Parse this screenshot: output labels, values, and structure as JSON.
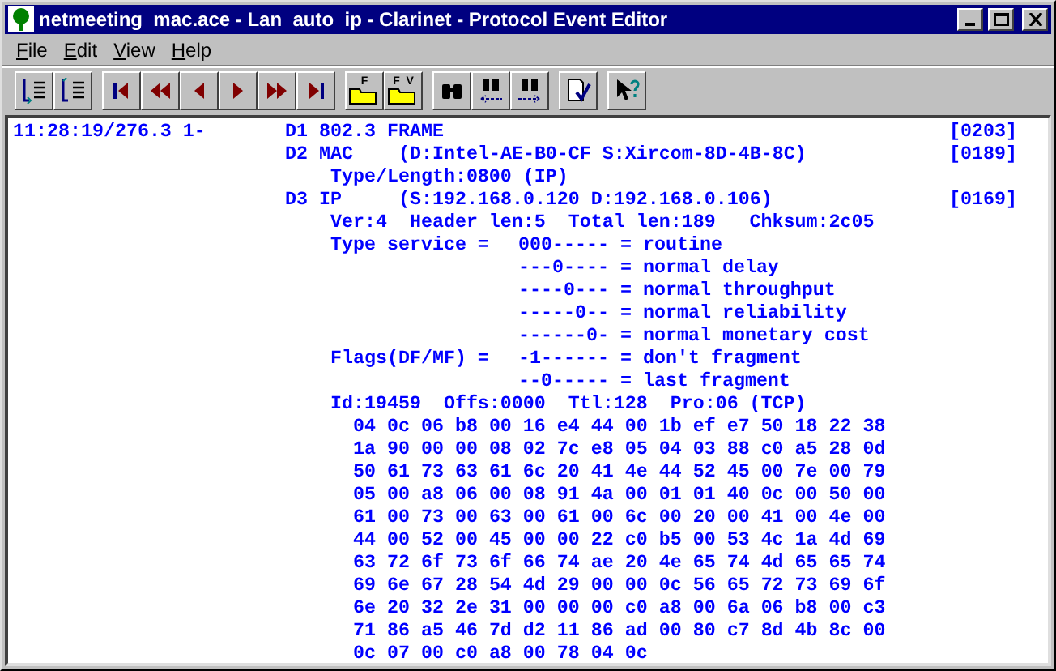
{
  "window": {
    "title": "netmeeting_mac.ace - Lan_auto_ip - Clarinet - Protocol Event Editor"
  },
  "menu": [
    {
      "label": "File"
    },
    {
      "label": "Edit"
    },
    {
      "label": "View"
    },
    {
      "label": "Help"
    }
  ],
  "toolbar": [
    [
      {
        "kind": "expand"
      },
      {
        "kind": "collapse"
      }
    ],
    [
      {
        "kind": "first"
      },
      {
        "kind": "fast-back"
      },
      {
        "kind": "back"
      },
      {
        "kind": "forward"
      },
      {
        "kind": "fast-forward"
      },
      {
        "kind": "last"
      }
    ],
    [
      {
        "kind": "folder",
        "letters": "F"
      },
      {
        "kind": "folder",
        "letters": "F  V"
      }
    ],
    [
      {
        "kind": "find"
      },
      {
        "kind": "find-prev"
      },
      {
        "kind": "find-next"
      }
    ],
    [
      {
        "kind": "check"
      }
    ],
    [
      {
        "kind": "help"
      }
    ]
  ],
  "event": {
    "time": "11:28:19/276.3 1-",
    "layers": [
      {
        "id": "D1",
        "name": "802.3 FRAME",
        "length": "[0203]"
      },
      {
        "id": "D2",
        "name": "MAC",
        "info": "(D:Intel-AE-B0-CF S:Xircom-8D-4B-8C)",
        "length": "[0189]",
        "details": [
          {
            "kind": "text",
            "text": "Type/Length:0800 (IP)"
          }
        ]
      },
      {
        "id": "D3",
        "name": "IP",
        "info": "(S:192.168.0.120 D:192.168.0.106)",
        "length": "[0169]",
        "details": [
          {
            "kind": "text",
            "text": "Ver:4  Header len:5  Total len:189   Chksum:2c05"
          },
          {
            "kind": "bits",
            "label": "Type service =",
            "pattern": "000-----",
            "meaning": "= routine"
          },
          {
            "kind": "bits",
            "pattern": "---0----",
            "meaning": "= normal delay"
          },
          {
            "kind": "bits",
            "pattern": "----0---",
            "meaning": "= normal throughput"
          },
          {
            "kind": "bits",
            "pattern": "-----0--",
            "meaning": "= normal reliability"
          },
          {
            "kind": "bits",
            "pattern": "------0-",
            "meaning": "= normal monetary cost"
          },
          {
            "kind": "bits",
            "label": "Flags(DF/MF) =",
            "pattern": "-1------",
            "meaning": "= don't fragment"
          },
          {
            "kind": "bits",
            "pattern": "--0-----",
            "meaning": "= last fragment"
          },
          {
            "kind": "text",
            "text": "Id:19459  Offs:0000  Ttl:128  Pro:06 (TCP)"
          },
          {
            "kind": "hex",
            "lines": [
              "04 0c 06 b8 00 16 e4 44 00 1b ef e7 50 18 22 38",
              "1a 90 00 00 08 02 7c e8 05 04 03 88 c0 a5 28 0d",
              "50 61 73 63 61 6c 20 41 4e 44 52 45 00 7e 00 79",
              "05 00 a8 06 00 08 91 4a 00 01 01 40 0c 00 50 00",
              "61 00 73 00 63 00 61 00 6c 00 20 00 41 00 4e 00",
              "44 00 52 00 45 00 00 22 c0 b5 00 53 4c 1a 4d 69",
              "63 72 6f 73 6f 66 74 ae 20 4e 65 74 4d 65 65 74",
              "69 6e 67 28 54 4d 29 00 00 0c 56 65 72 73 69 6f",
              "6e 20 32 2e 31 00 00 00 c0 a8 00 6a 06 b8 00 c3",
              "71 86 a5 46 7d d2 11 86 ad 00 80 c7 8d 4b 8c 00",
              "0c 07 00 c0 a8 00 78 04 0c"
            ]
          }
        ]
      }
    ]
  }
}
